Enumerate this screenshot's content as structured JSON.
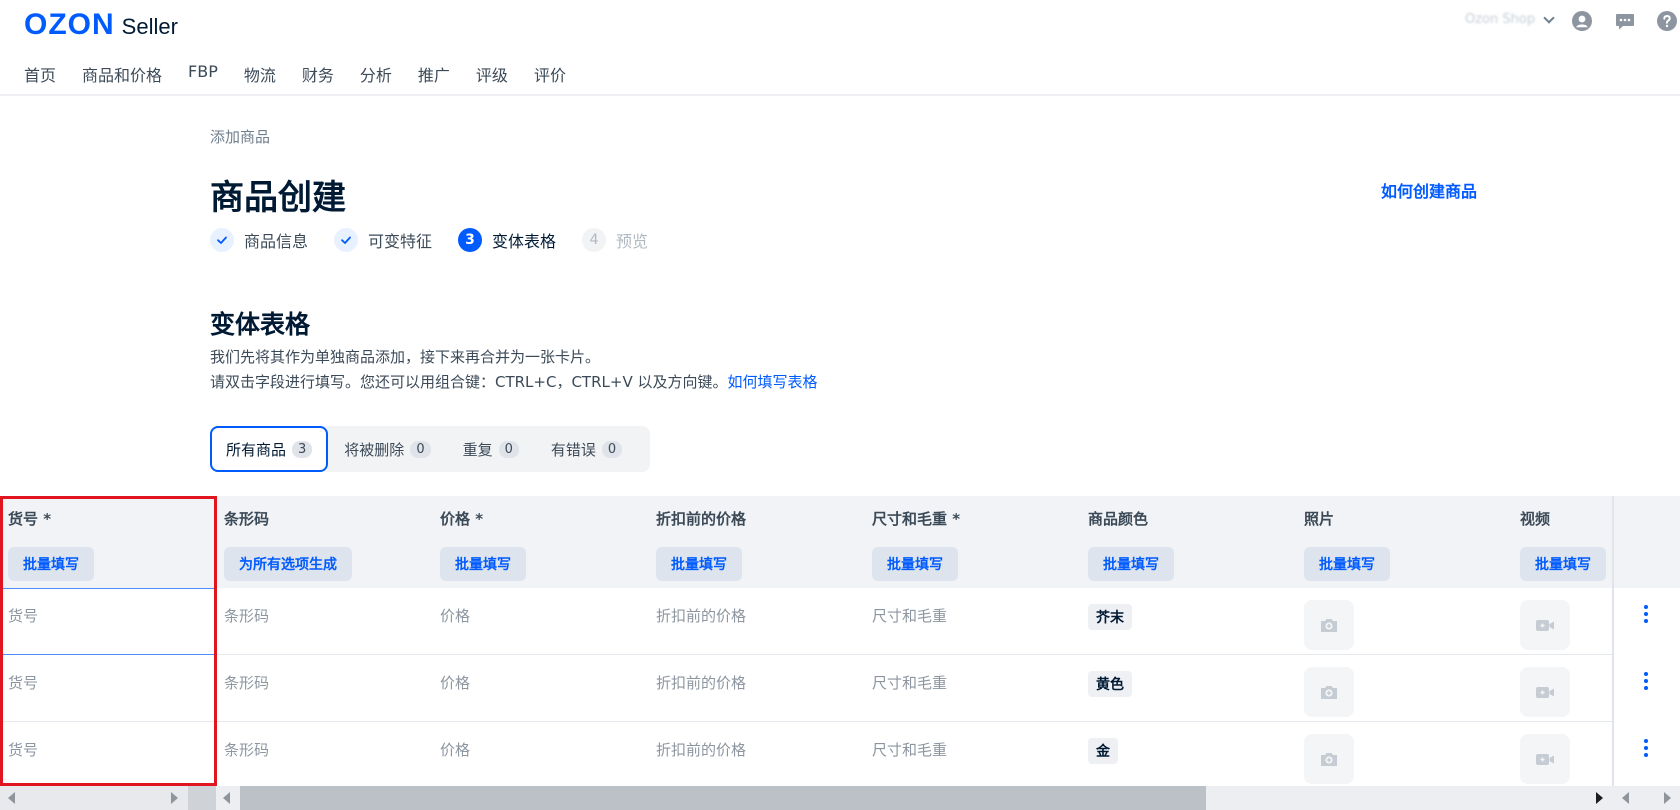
{
  "header": {
    "logo_brand": "OZON",
    "logo_product": "Seller",
    "account_name": "Ozon Shop",
    "icons": [
      "chevron-down-icon",
      "profile-icon",
      "chat-icon",
      "help-icon"
    ]
  },
  "nav": {
    "items": [
      "首页",
      "商品和价格",
      "FBP",
      "物流",
      "财务",
      "分析",
      "推广",
      "评级",
      "评价"
    ]
  },
  "page": {
    "breadcrumb": "添加商品",
    "title": "商品创建",
    "help_link": "如何创建商品"
  },
  "steps": [
    {
      "label": "商品信息",
      "state": "done",
      "number": "1"
    },
    {
      "label": "可变特征",
      "state": "done",
      "number": "2"
    },
    {
      "label": "变体表格",
      "state": "active",
      "number": "3"
    },
    {
      "label": "预览",
      "state": "todo",
      "number": "4"
    }
  ],
  "section": {
    "title": "变体表格",
    "desc1": "我们先将其作为单独商品添加，接下来再合并为一张卡片。",
    "desc2": "请双击字段进行填写。您还可以用组合键：CTRL+C，CTRL+V 以及方向键。",
    "desc2_link": "如何填写表格"
  },
  "filter_tabs": [
    {
      "label": "所有商品",
      "count": "3",
      "active": true
    },
    {
      "label": "将被删除",
      "count": "0",
      "active": false
    },
    {
      "label": "重复",
      "count": "0",
      "active": false
    },
    {
      "label": "有错误",
      "count": "0",
      "active": false
    }
  ],
  "table": {
    "columns": [
      {
        "label": "货号 *",
        "button": "批量填写"
      },
      {
        "label": "条形码",
        "button": "为所有选项生成"
      },
      {
        "label": "价格 *",
        "button": "批量填写"
      },
      {
        "label": "折扣前的价格",
        "button": "批量填写"
      },
      {
        "label": "尺寸和毛重 *",
        "button": "批量填写"
      },
      {
        "label": "商品颜色",
        "button": "批量填写"
      },
      {
        "label": "照片",
        "button": "批量填写"
      },
      {
        "label": "视频",
        "button": "批量填写"
      }
    ],
    "placeholders": {
      "sku": "货号",
      "barcode": "条形码",
      "price": "价格",
      "old_price": "折扣前的价格",
      "dimensions": "尺寸和毛重"
    },
    "rows": [
      {
        "color": "芥末"
      },
      {
        "color": "黄色"
      },
      {
        "color": "金"
      }
    ],
    "row_icons": [
      "add-photo-icon",
      "add-video-icon",
      "more-vertical-icon"
    ]
  },
  "colors": {
    "accent": "#005bff",
    "selection": "#e0151f"
  }
}
